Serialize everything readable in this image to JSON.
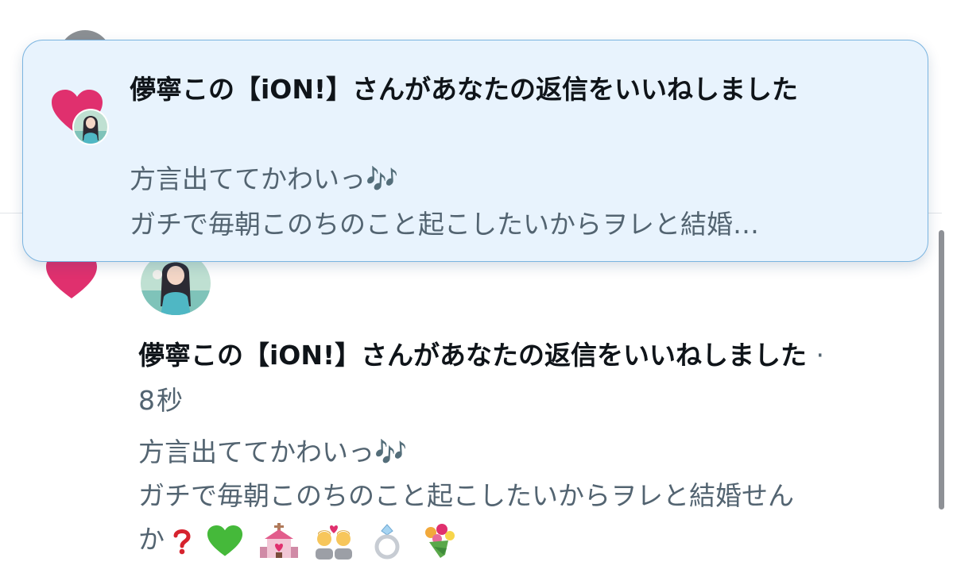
{
  "toast": {
    "title": "儚寧この【iON!】さんがあなたの返信をいいねしました",
    "body_line1": "方言出ててかわいっ🎶",
    "body_line2": "ガチで毎朝このちのこと起こしたいからヲレと結婚…",
    "icon": "heart-icon"
  },
  "notification": {
    "title": "儚寧この【iON!】さんがあなたの返信をいいねしました",
    "separator": "·",
    "time": "8秒",
    "body_line1": "方言出ててかわいっ🎶",
    "body_line2": "ガチで毎朝このちのこと起こしたいからヲレと結婚せん",
    "body_line3_text": "か",
    "body_emojis": [
      "question-mark",
      "green-heart",
      "wedding-chapel",
      "couple-with-heart",
      "ring",
      "bouquet"
    ],
    "icon": "heart-icon"
  },
  "colors": {
    "heart": "#e0306e",
    "secondary_text": "#536471",
    "toast_background": "#e8f3fd",
    "toast_border": "#7ab4e0"
  }
}
